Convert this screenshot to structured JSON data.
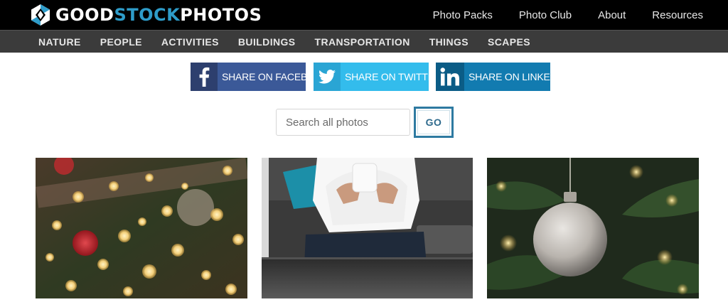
{
  "brand": {
    "part1": "GOOD",
    "part2": "STOCK",
    "part3": "PHOTOS"
  },
  "top_nav": [
    "Photo Packs",
    "Photo Club",
    "About",
    "Resources"
  ],
  "categories": [
    "NATURE",
    "PEOPLE",
    "ACTIVITIES",
    "BUILDINGS",
    "TRANSPORTATION",
    "THINGS",
    "SCAPES"
  ],
  "share": {
    "facebook": "SHARE ON FACEBOOK",
    "twitter": "SHARE ON TWITTER",
    "linkedin": "SHARE ON LINKEDIN"
  },
  "search": {
    "placeholder": "Search all photos",
    "button": "GO"
  },
  "colors": {
    "brand_accent": "#2e9cc9",
    "facebook": "#3b5998",
    "twitter": "#33bcec",
    "linkedin": "#127bb0",
    "go_border": "#2e7aa1"
  }
}
